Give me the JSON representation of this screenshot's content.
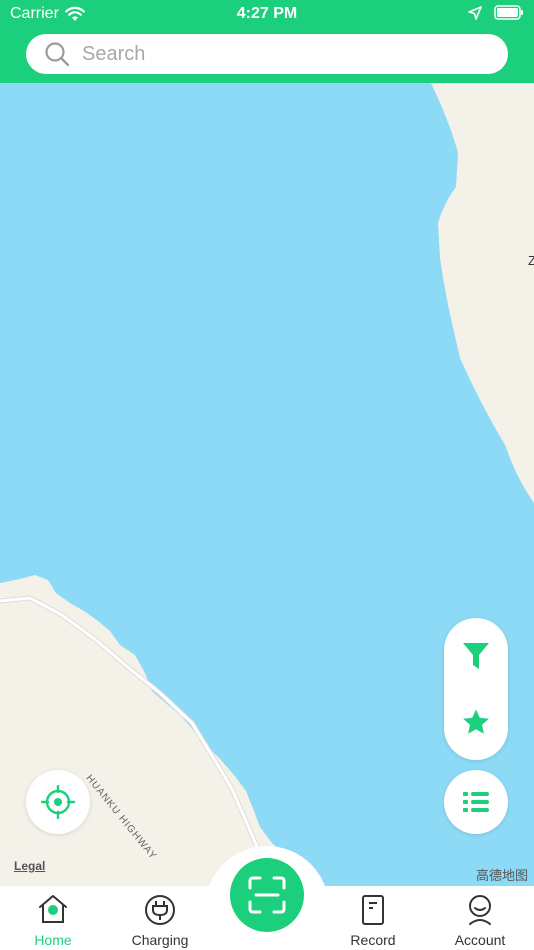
{
  "status_bar": {
    "carrier": "Carrier",
    "time": "4:27 PM"
  },
  "search": {
    "placeholder": "Search",
    "value": ""
  },
  "map": {
    "road_label": "HUANKU HIGHWAY",
    "legal": "Legal",
    "provider": "高德地图",
    "edge_label": "Z"
  },
  "tabs": [
    {
      "label": "Home",
      "icon": "home-icon",
      "active": true
    },
    {
      "label": "Charging",
      "icon": "plug-icon",
      "active": false
    },
    {
      "label": "Record",
      "icon": "record-icon",
      "active": false
    },
    {
      "label": "Account",
      "icon": "account-icon",
      "active": false
    }
  ],
  "colors": {
    "accent": "#1ccf7c",
    "water": "#8cdaf5",
    "land": "#f4f1e9"
  }
}
